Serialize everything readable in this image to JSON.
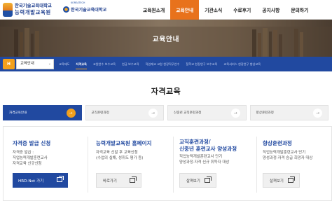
{
  "header": {
    "logo_line1": "한국기술교육대학교",
    "logo_line2": "능력개발교육원",
    "partner_sup": "KOREATECH",
    "partner_name": "한국기술교육대학교",
    "nav": [
      {
        "label": "교육원소개",
        "active": false
      },
      {
        "label": "교육안내",
        "active": true
      },
      {
        "label": "기관소식",
        "active": false
      },
      {
        "label": "수료후기",
        "active": false
      },
      {
        "label": "공지사항",
        "active": false
      },
      {
        "label": "문의하기",
        "active": false
      }
    ]
  },
  "hero": {
    "title": "교육안내"
  },
  "location": {
    "home_glyph": "H",
    "select_value": "교육안내",
    "subnav": [
      {
        "label": "교육제도",
        "active": false
      },
      {
        "label": "자격교육",
        "active": true
      },
      {
        "label": "교원연수 보수교육",
        "active": false
      },
      {
        "label": "연금 보수교육",
        "active": false
      },
      {
        "label": "직업재교 교원 현장직무연수",
        "active": false
      },
      {
        "label": "철학교 현장연구 보수교육",
        "active": false
      },
      {
        "label": "교육서비스 현장연구 향상교육",
        "active": false
      }
    ]
  },
  "page_title": "자격교육",
  "tabs": [
    {
      "label": "자격교육안내",
      "active": true
    },
    {
      "label": "교직훈련과정",
      "active": false
    },
    {
      "label": "신중년 교직훈련과정",
      "active": false
    },
    {
      "label": "향상훈련과정",
      "active": false
    }
  ],
  "columns": [
    {
      "title": "자격증 발급 신청",
      "desc": [
        "자격증 발급 :",
        "직업능력개발훈련교사",
        "자격교육 신규신청"
      ],
      "button": "HRD-Net 가기",
      "primary": true
    },
    {
      "title": "능력개발교육원 홈페이지",
      "desc": [
        "자격교육 선발 후 교육신청",
        "(수업의 실해, 성취도 평가 등)"
      ],
      "button": "바로가기",
      "primary": false
    },
    {
      "title": "교직훈련과정/",
      "title2": "신중년 훈련교사 양성과정",
      "desc": [
        "직업능력개발훈련교사 단기",
        "양성과정·자격 신규 취득자 대상"
      ],
      "button": "살펴보기",
      "primary": false
    },
    {
      "title": "향상훈련과정",
      "desc": [
        "직업능력개발훈련교사 단기",
        "양성과정·자격 승급 희망자 대상"
      ],
      "button": "살펴보기",
      "primary": false
    }
  ],
  "colors": {
    "brand_blue": "#2149a0",
    "accent_orange": "#e8721c"
  }
}
